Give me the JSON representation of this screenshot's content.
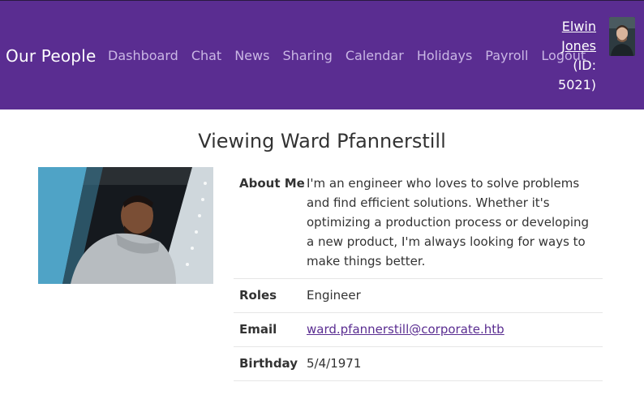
{
  "navbar": {
    "brand": "Our People",
    "links": [
      "Dashboard",
      "Chat",
      "News",
      "Sharing",
      "Calendar",
      "Holidays",
      "Payroll",
      "Logout"
    ],
    "user": {
      "first": "Elwin",
      "last": "Jones",
      "id_line1": "(ID:",
      "id_line2": "5021)"
    }
  },
  "page": {
    "title": "Viewing Ward Pfannerstill"
  },
  "profile": {
    "about_label": "About Me",
    "about": "I'm an engineer who loves to solve problems and find efficient solutions. Whether it's optimizing a production process or developing a new product, I'm always looking for ways to make things better.",
    "roles_label": "Roles",
    "roles": "Engineer",
    "email_label": "Email",
    "email": "ward.pfannerstill@corporate.htb",
    "birthday_label": "Birthday",
    "birthday": "5/4/1971"
  },
  "colors": {
    "navbar_bg": "#5a2d91",
    "link": "#c9b6e4"
  }
}
